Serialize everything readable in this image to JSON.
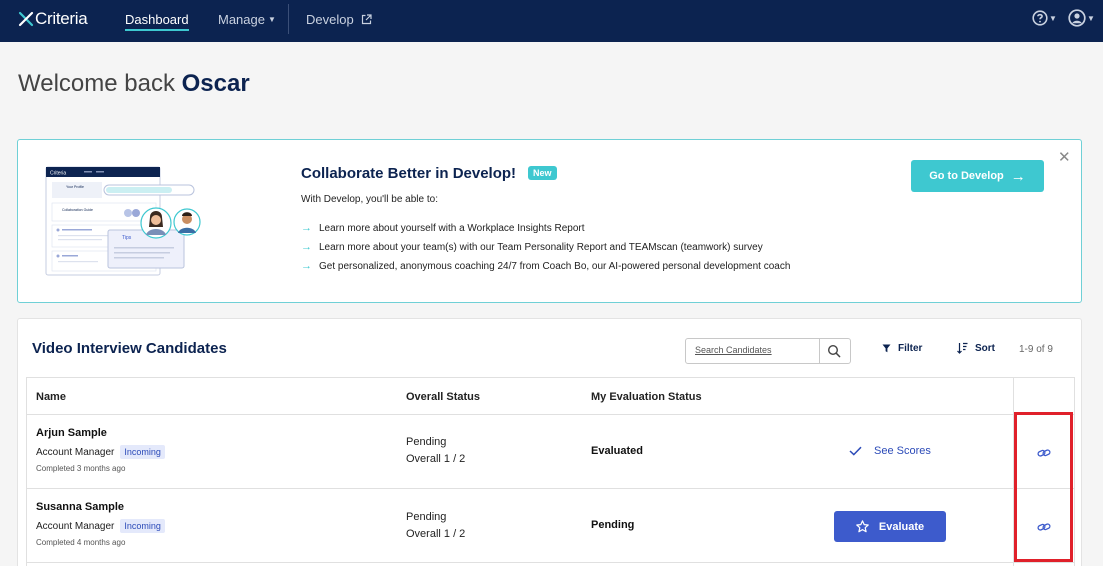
{
  "nav": {
    "logo": "Criteria",
    "dashboard": "Dashboard",
    "manage": "Manage",
    "develop": "Develop"
  },
  "welcome": {
    "prefix": "Welcome back",
    "name": "Oscar"
  },
  "banner": {
    "title": "Collaborate Better in Develop!",
    "badge": "New",
    "subtitle": "With Develop, you'll be able to:",
    "bullets": [
      "Learn more about yourself with a Workplace Insights Report",
      "Learn more about your team(s) with our Team Personality Report and TEAMscan (teamwork) survey",
      "Get personalized, anonymous coaching 24/7 from Coach Bo, our AI-powered personal development coach"
    ],
    "button": "Go to Develop",
    "illustration": {
      "logo": "Criteria",
      "profile": "Your Profile",
      "collab": "Collaboration Guide",
      "tips": "Tips"
    }
  },
  "candidates": {
    "title": "Video Interview Candidates",
    "search_placeholder": "Search Candidates",
    "filter": "Filter",
    "sort": "Sort",
    "count": "1-9 of 9",
    "columns": {
      "name": "Name",
      "overall": "Overall Status",
      "evaluation": "My Evaluation Status"
    },
    "rows": [
      {
        "name": "Arjun Sample",
        "role": "Account Manager",
        "tag": "Incoming",
        "completed": "Completed 3 months ago",
        "status": "Pending",
        "overall": "Overall 1 / 2",
        "evaluation": "Evaluated",
        "action": "See Scores"
      },
      {
        "name": "Susanna Sample",
        "role": "Account Manager",
        "tag": "Incoming",
        "completed": "Completed 4 months ago",
        "status": "Pending",
        "overall": "Overall 1 / 2",
        "evaluation": "Pending",
        "action": "Evaluate"
      }
    ]
  },
  "colors": {
    "navy": "#0c2350",
    "teal": "#3ec8d0",
    "blue": "#3d5bcc",
    "highlight": "#e0202a"
  }
}
